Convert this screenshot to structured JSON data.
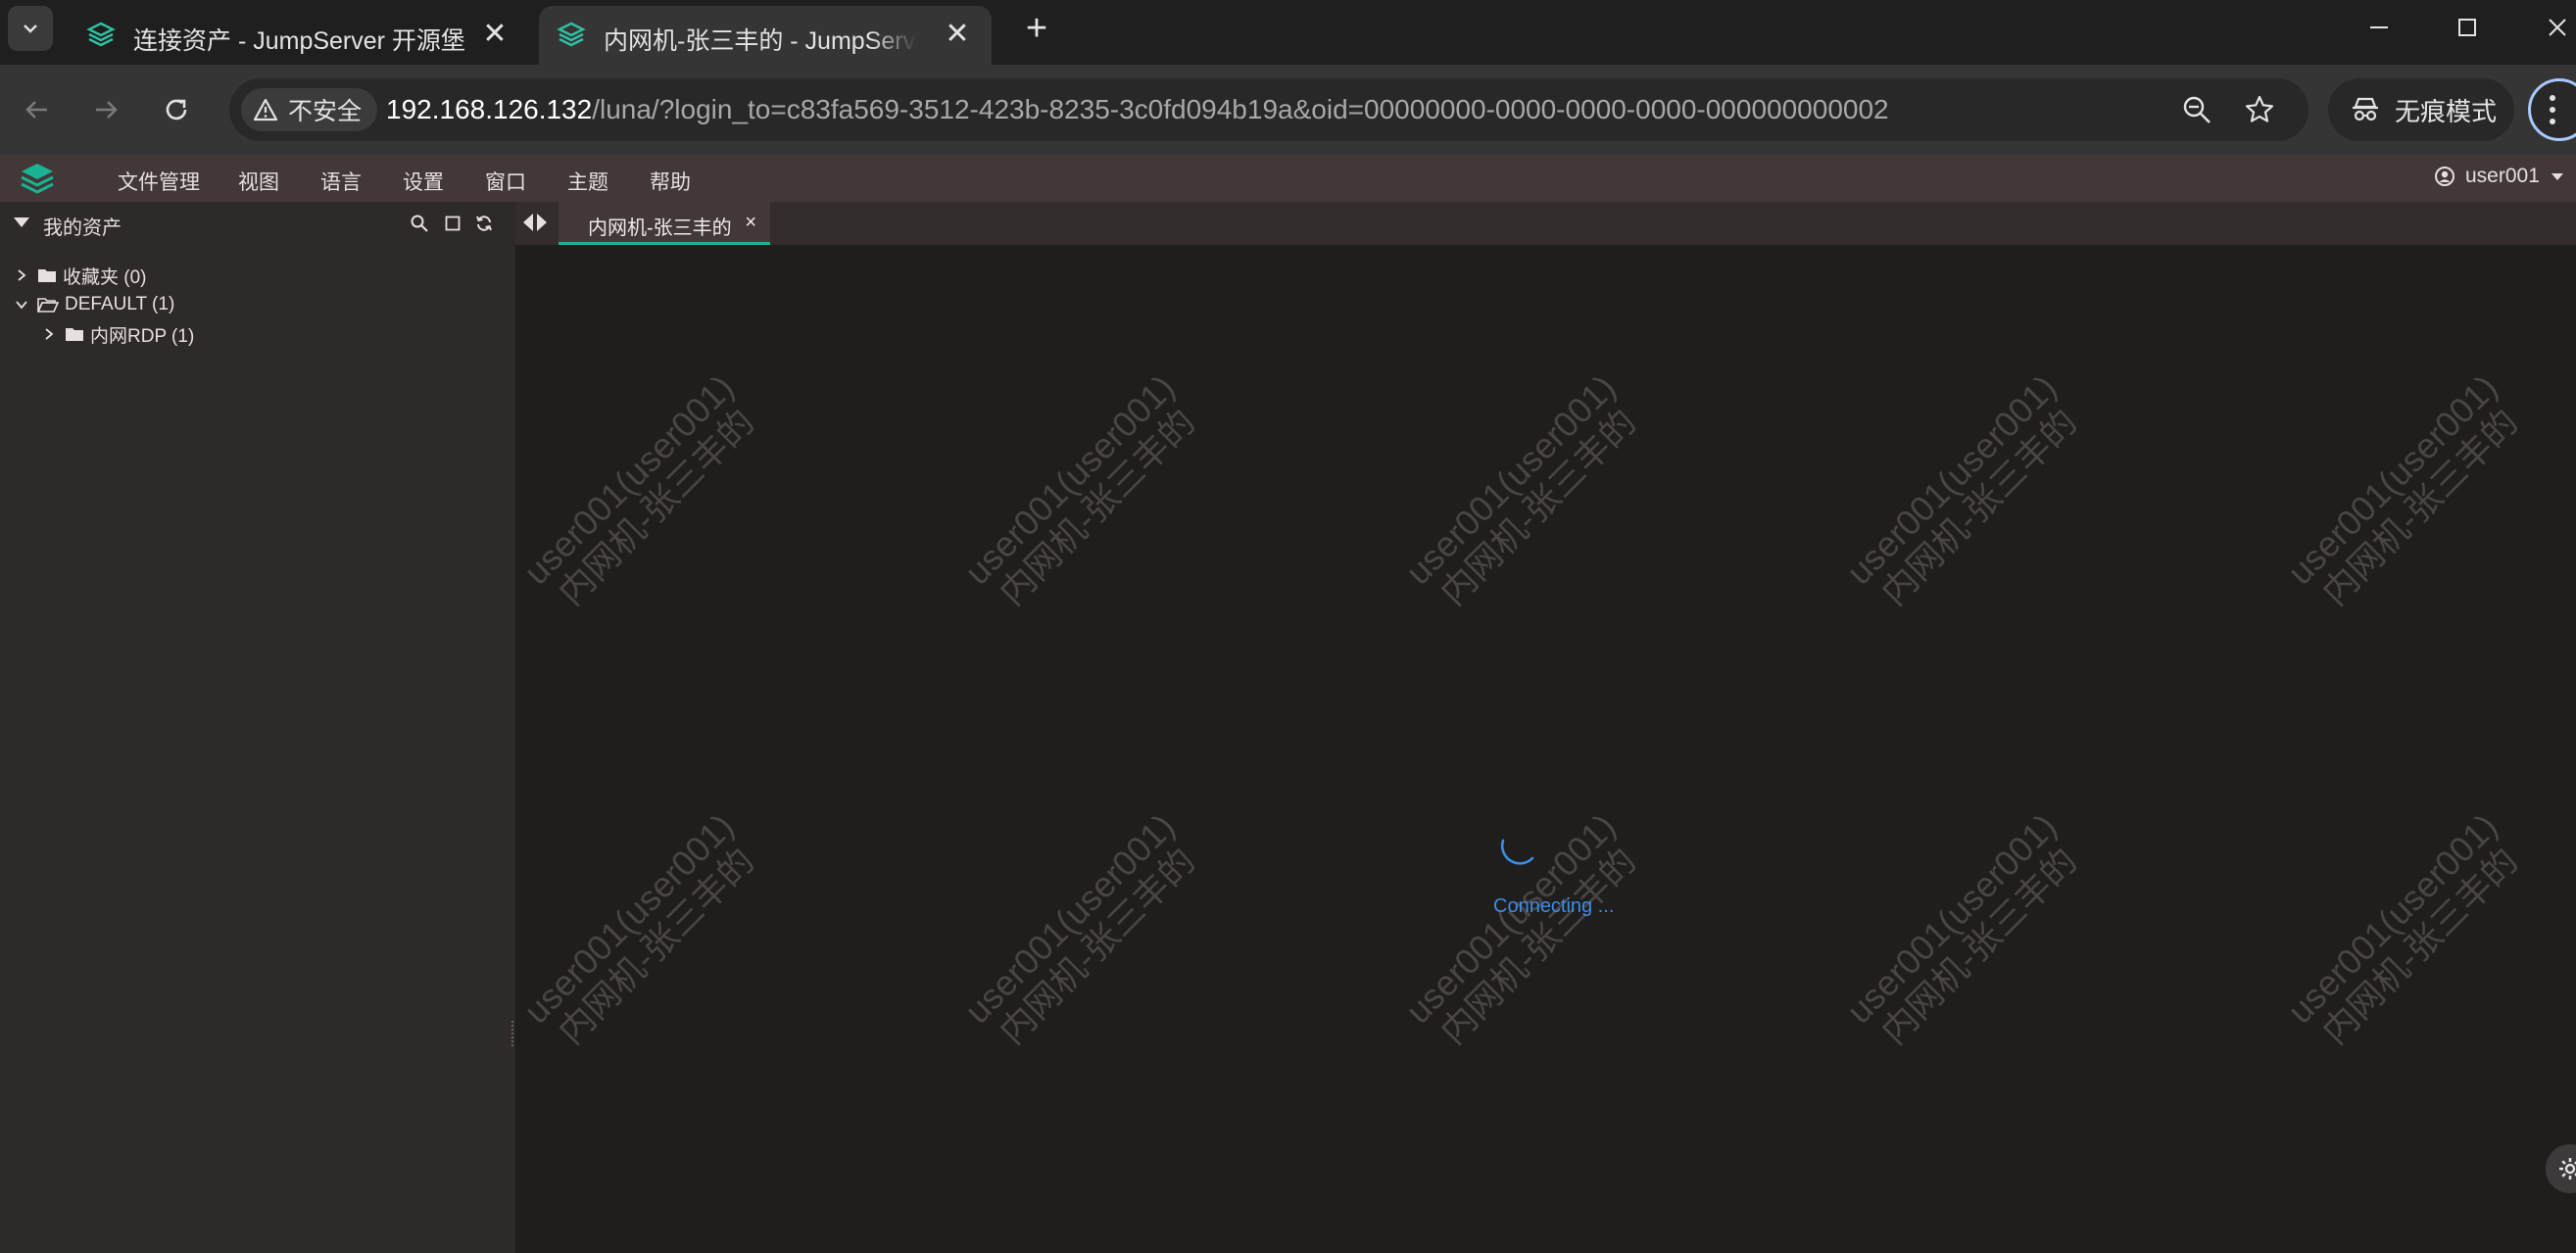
{
  "browser": {
    "tabs": [
      {
        "title": "连接资产 - JumpServer 开源堡垒机",
        "close": "✕"
      },
      {
        "title": "内网机-张三丰的 - JumpServer",
        "close": "✕"
      }
    ],
    "new_tab": "+",
    "security_chip": "不安全",
    "url_host": "192.168.126.132",
    "url_path": "/luna/?login_to=c83fa569-3512-423b-8235-3c0fd094b19a&oid=00000000-0000-0000-0000-000000000002",
    "incognito_label": "无痕模式"
  },
  "app": {
    "menu": [
      "文件管理",
      "视图",
      "语言",
      "设置",
      "窗口",
      "主题",
      "帮助"
    ],
    "user": "user001",
    "accent_color": "#1ab394"
  },
  "sidebar": {
    "title": "我的资产",
    "tree": [
      {
        "label": "收藏夹 (0)"
      },
      {
        "label": "DEFAULT (1)"
      },
      {
        "label": "内网RDP (1)"
      }
    ]
  },
  "session": {
    "tab_label": "内网机-张三丰的",
    "tab_close": "×",
    "watermark_line1": "user001(user001)",
    "watermark_line2": "内网机-张三丰的",
    "status": "Connecting ..."
  }
}
